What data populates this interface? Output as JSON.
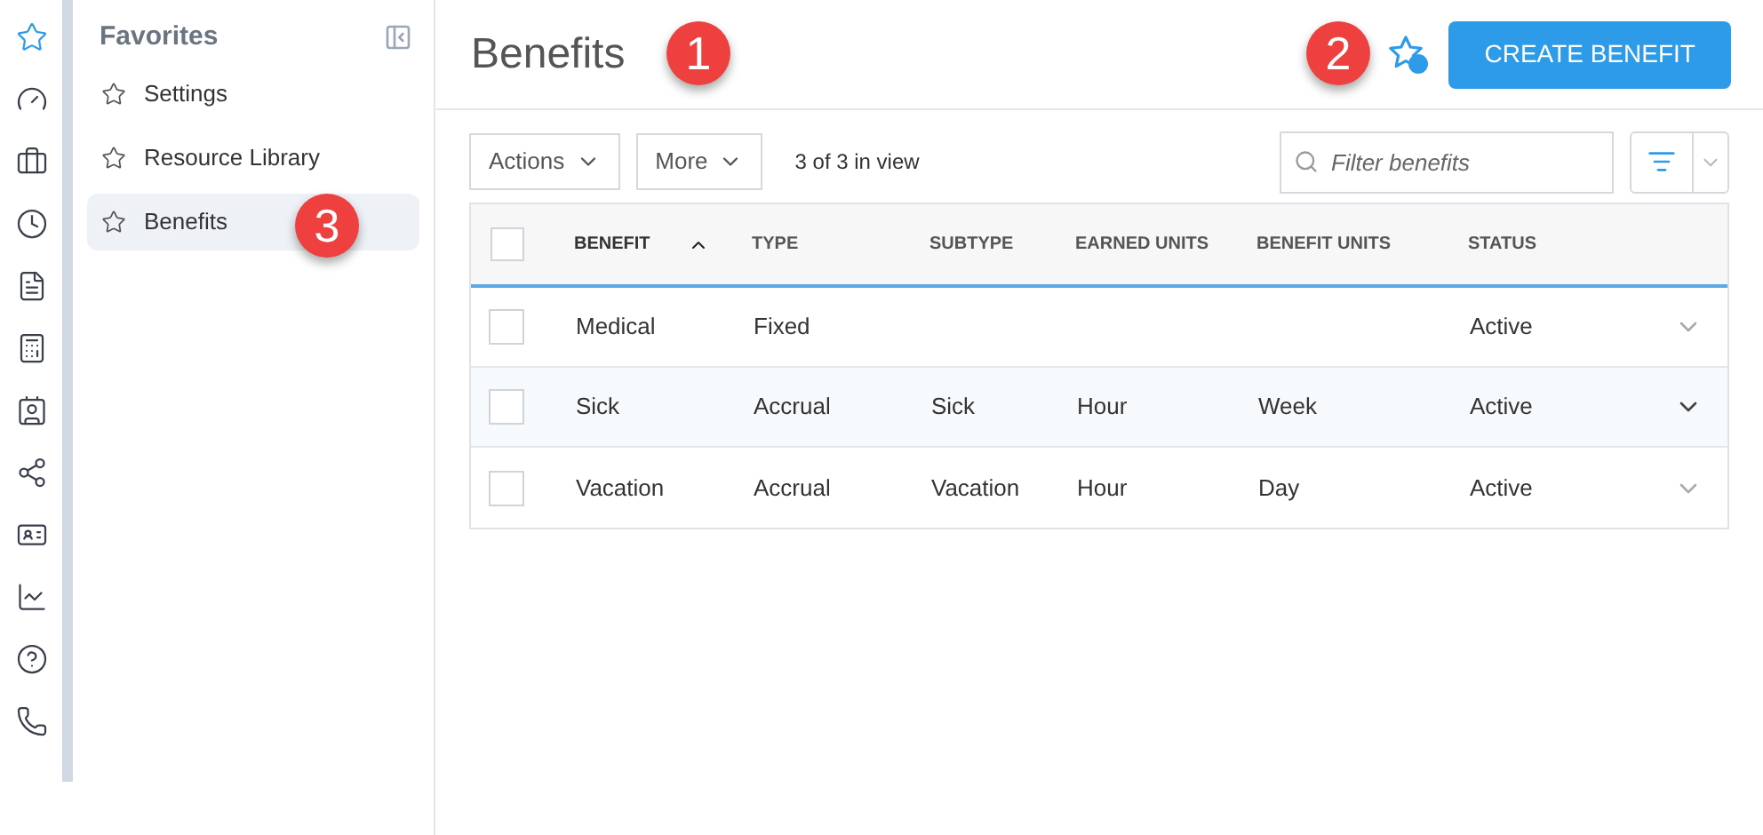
{
  "rail": {
    "items": [
      {
        "selected": true
      },
      {
        "selected": false
      },
      {
        "selected": false
      },
      {
        "selected": false
      },
      {
        "selected": false
      },
      {
        "selected": false
      },
      {
        "selected": false
      },
      {
        "selected": false
      },
      {
        "selected": false
      },
      {
        "selected": false
      },
      {
        "selected": false
      },
      {
        "selected": false
      }
    ]
  },
  "favorites": {
    "title": "Favorites",
    "items": [
      {
        "label": "Settings",
        "selected": false
      },
      {
        "label": "Resource Library",
        "selected": false
      },
      {
        "label": "Benefits",
        "selected": true
      }
    ]
  },
  "page": {
    "title": "Benefits",
    "create_button": "CREATE BENEFIT"
  },
  "toolbar": {
    "actions": "Actions",
    "more": "More",
    "count": "3 of 3 in view",
    "filter_placeholder": "Filter benefits"
  },
  "table": {
    "all_checked": false,
    "columns": [
      {
        "label": "BENEFIT",
        "sorted": true
      },
      {
        "label": "TYPE",
        "sorted": false
      },
      {
        "label": "SUBTYPE",
        "sorted": false
      },
      {
        "label": "EARNED UNITS",
        "sorted": false
      },
      {
        "label": "BENEFIT UNITS",
        "sorted": false
      },
      {
        "label": "STATUS",
        "sorted": false
      }
    ],
    "rows": [
      {
        "cells": [
          "Medical",
          "Fixed",
          "",
          "",
          "",
          "Active"
        ],
        "checked": false,
        "highlighted": false
      },
      {
        "cells": [
          "Sick",
          "Accrual",
          "Sick",
          "Hour",
          "Week",
          "Active"
        ],
        "checked": false,
        "highlighted": true
      },
      {
        "cells": [
          "Vacation",
          "Accrual",
          "Vacation",
          "Hour",
          "Day",
          "Active"
        ],
        "checked": false,
        "highlighted": false
      }
    ]
  },
  "callouts": [
    "1",
    "2",
    "3"
  ]
}
